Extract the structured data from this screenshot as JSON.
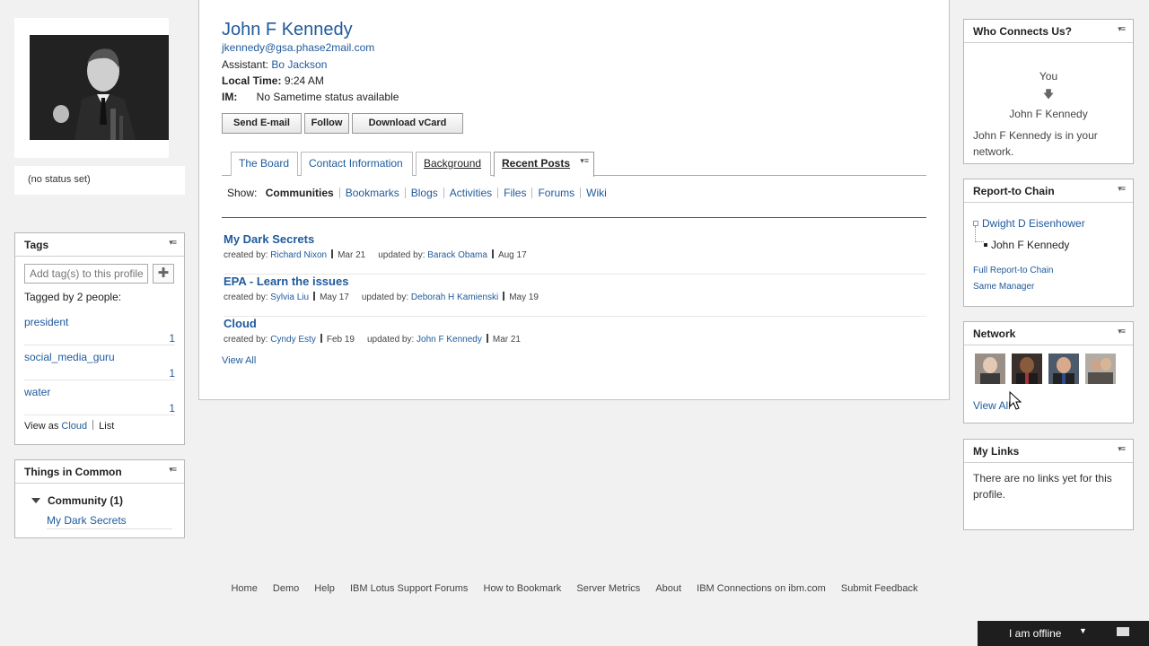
{
  "profile": {
    "name": "John F Kennedy",
    "email": "jkennedy@gsa.phase2mail.com",
    "assistant_label": "Assistant:",
    "assistant": "Bo Jackson",
    "local_time_label": "Local Time:",
    "local_time": "9:24 AM",
    "im_label": "IM:",
    "im_status": "No Sametime status available",
    "status": "(no status set)"
  },
  "actions": {
    "send_email": "Send E-mail",
    "follow": "Follow",
    "download_vcard": "Download vCard"
  },
  "tabs": [
    "The Board",
    "Contact Information",
    "Background",
    "Recent Posts"
  ],
  "filter": {
    "show_label": "Show:",
    "items": [
      "Communities",
      "Bookmarks",
      "Blogs",
      "Activities",
      "Files",
      "Forums",
      "Wiki"
    ]
  },
  "posts": [
    {
      "title": "My Dark Secrets",
      "created_label": "created by:",
      "created_by": "Richard Nixon",
      "created_date": "Mar 21",
      "updated_label": "updated by:",
      "updated_by": "Barack Obama",
      "updated_date": "Aug 17"
    },
    {
      "title": "EPA - Learn the issues",
      "created_label": "created by:",
      "created_by": "Sylvia Liu",
      "created_date": "May 17",
      "updated_label": "updated by:",
      "updated_by": "Deborah H Kamienski",
      "updated_date": "May 19"
    },
    {
      "title": "Cloud",
      "created_label": "created by:",
      "created_by": "Cyndy Esty",
      "created_date": "Feb 19",
      "updated_label": "updated by:",
      "updated_by": "John F Kennedy",
      "updated_date": "Mar 21"
    }
  ],
  "view_all": "View All",
  "tags_widget": {
    "title": "Tags",
    "input_placeholder": "Add tag(s) to this profile",
    "tagged_by": "Tagged by 2 people:",
    "tags": [
      {
        "name": "president",
        "count": "1"
      },
      {
        "name": "social_media_guru",
        "count": "1"
      },
      {
        "name": "water",
        "count": "1"
      }
    ],
    "view_as_label": "View as",
    "cloud": "Cloud",
    "list": "List"
  },
  "common_widget": {
    "title": "Things in Common",
    "group": "Community (1)",
    "item": "My Dark Secrets"
  },
  "who_widget": {
    "title": "Who Connects Us?",
    "you": "You",
    "target": "John F Kennedy",
    "note": "John F Kennedy is in your network."
  },
  "chain_widget": {
    "title": "Report-to Chain",
    "manager": "Dwight D Eisenhower",
    "self": "John F Kennedy",
    "full_chain": "Full Report-to Chain",
    "same_manager": "Same Manager"
  },
  "network_widget": {
    "title": "Network",
    "view_all": "View All"
  },
  "links_widget": {
    "title": "My Links",
    "empty": "There are no links yet for this profile."
  },
  "footer": [
    "Home",
    "Demo",
    "Help",
    "IBM Lotus Support Forums",
    "How to Bookmark",
    "Server Metrics",
    "About",
    "IBM Connections on ibm.com",
    "Submit Feedback"
  ],
  "chat": {
    "status": "I am offline"
  },
  "icons": {
    "widget_menu": "menu-icon",
    "add_tag": "plus-icon",
    "arrow_down": "arrow-down-icon",
    "chat": "chat-bubble-icon"
  },
  "colors": {
    "link": "#1f5a9c",
    "bar": "#1e1e1e",
    "background": "#f1f1f1"
  }
}
